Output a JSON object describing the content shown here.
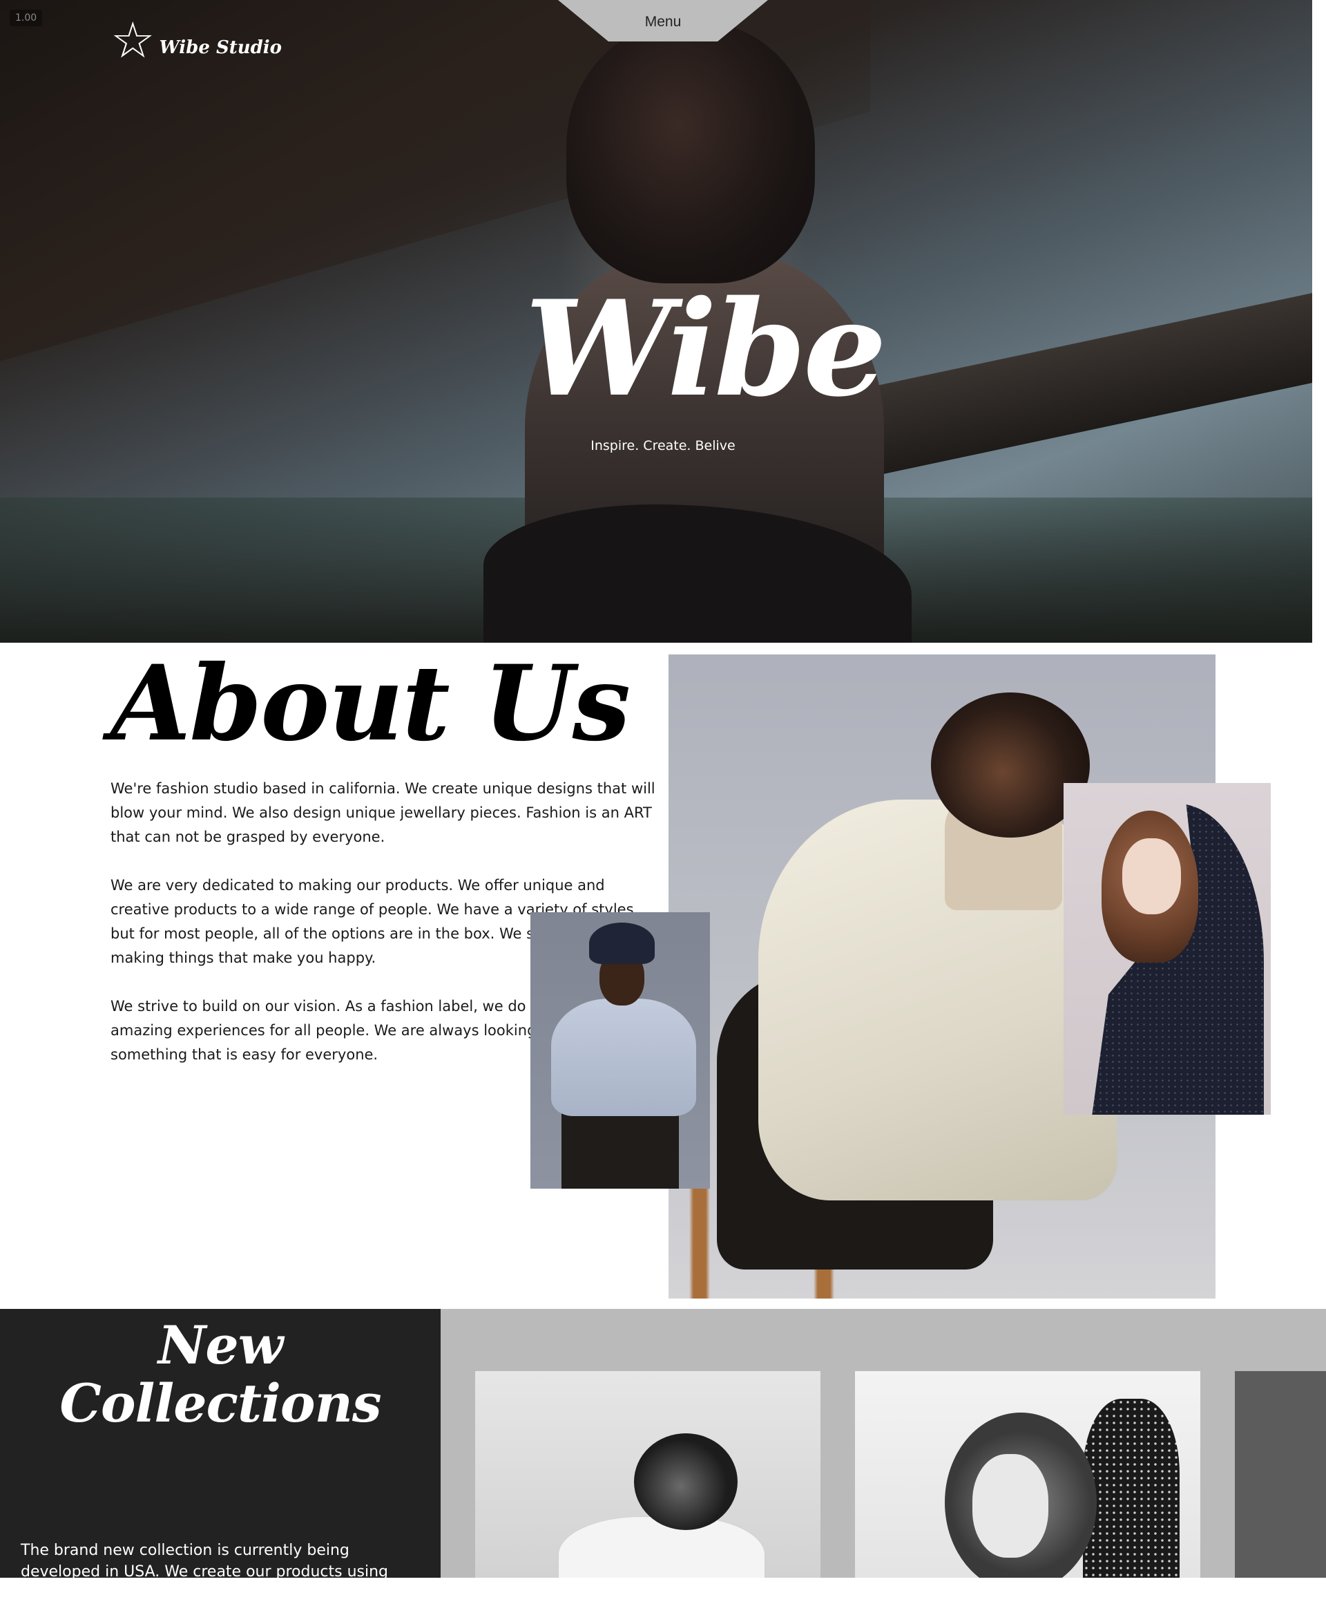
{
  "app": {
    "version_badge": "1.00"
  },
  "header": {
    "logo_icon": "star-outline-icon",
    "logo_text": "Wibe Studio",
    "menu_label": "Menu"
  },
  "hero": {
    "title": "Wibe",
    "tagline": "Inspire. Create. Belive"
  },
  "about": {
    "title": "About Us",
    "paragraphs": [
      "We're fashion studio based in california. We create unique designs that will blow your mind. We also design unique jewellary pieces. Fashion is an ART that can not be grasped by everyone.",
      "We are very dedicated to making our products. We offer unique and creative products to a wide range of people. We have a variety of styles, but for most people, all of the options are in the box. We specialize in making things that make you happy.",
      "We strive to build on our vision. As a fashion label, we do our best to create amazing experiences for all people. We are always looking to make something that is easy for everyone."
    ]
  },
  "collections": {
    "title": "New Collections",
    "text": "The brand new collection is currently being developed in USA. We create our products using best quality material"
  },
  "colors": {
    "dark_panel": "#222222",
    "grey_panel": "#bababa",
    "menu_tab": "#bdbdbd",
    "text_dark": "#1a1a1a"
  }
}
